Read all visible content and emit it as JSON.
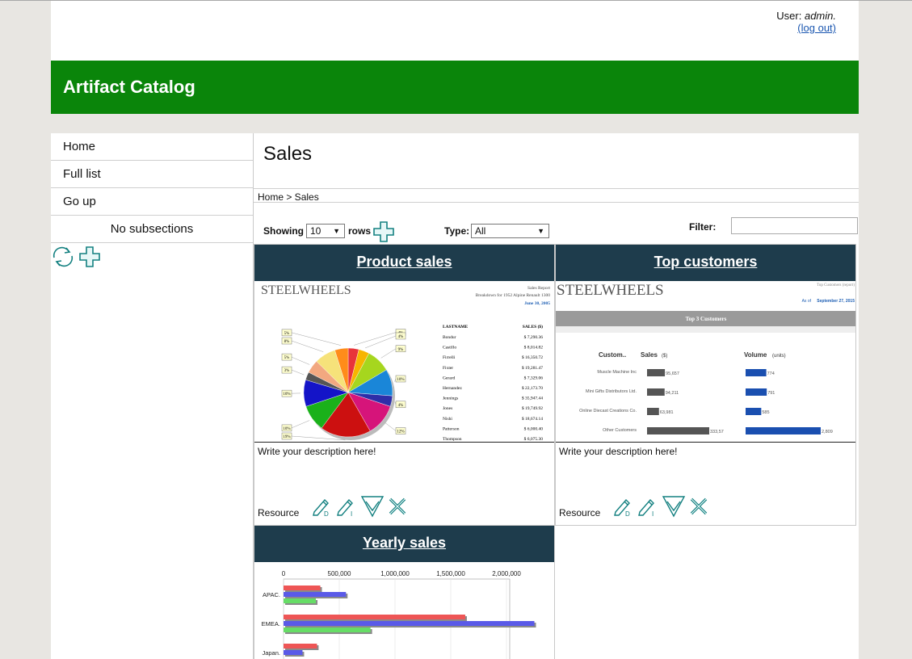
{
  "user": {
    "label": "User:",
    "name": "admin.",
    "logout": "(log out)"
  },
  "app_title": "Artifact Catalog",
  "sidebar": {
    "items": [
      {
        "label": "Home"
      },
      {
        "label": "Full list"
      },
      {
        "label": "Go up"
      }
    ],
    "no_subsections": "No subsections"
  },
  "main": {
    "title": "Sales",
    "breadcrumb": "Home > Sales",
    "showing_label": "Showing",
    "rows_value": "10",
    "rows_label": "rows",
    "type_label": "Type:",
    "type_value": "All",
    "filter_label": "Filter:",
    "filter_value": ""
  },
  "cards": [
    {
      "title": "Product sales",
      "description": "Write your description here!",
      "resource_label": "Resource",
      "thumb": {
        "brand": "STEELWHEELS",
        "report_title": "Sales Report",
        "report_sub": "Breakdown for 1952 Alpine Renault 1300",
        "report_date": "June 30, 2005",
        "col_name": "LASTNAME",
        "col_sales": "SALES ($)",
        "rows": [
          [
            "Bondur",
            "$ 7,290.36"
          ],
          [
            "Castillo",
            "$ 8,014.82"
          ],
          [
            "Firrelli",
            "$ 16,350.72"
          ],
          [
            "Fixter",
            "$ 19,281.47"
          ],
          [
            "Gerard",
            "$ 7,329.06"
          ],
          [
            "Hernandez",
            "$ 22,173.70"
          ],
          [
            "Jennings",
            "$ 35,947.44"
          ],
          [
            "Jones",
            "$ 19,749.92"
          ],
          [
            "Nishi",
            "$ 18,674.14"
          ],
          [
            "Patterson",
            "$ 6,000.40"
          ],
          [
            "Thompson",
            "$ 6,075.30"
          ]
        ],
        "pie": [
          {
            "value": 4,
            "color": "#e8343a",
            "label": "4%"
          },
          {
            "value": 4,
            "color": "#f7b500",
            "label": "4%"
          },
          {
            "value": 9,
            "color": "#a6d61e",
            "label": "9%"
          },
          {
            "value": 10,
            "color": "#1a86d8",
            "label": "10%"
          },
          {
            "value": 4,
            "color": "#2e2ea8",
            "label": "4%"
          },
          {
            "value": 12,
            "color": "#d6147a",
            "label": "12%"
          },
          {
            "value": 19,
            "color": "#cc1010",
            "label": "19%"
          },
          {
            "value": 10,
            "color": "#1ab11a",
            "label": "10%"
          },
          {
            "value": 10,
            "color": "#1414c8",
            "label": "10%"
          },
          {
            "value": 3,
            "color": "#555555",
            "label": "3%"
          },
          {
            "value": 5,
            "color": "#f2a880",
            "label": "5%"
          },
          {
            "value": 8,
            "color": "#f6e27a",
            "label": "8%"
          },
          {
            "value": 5,
            "color": "#ff8c1a",
            "label": "5%"
          }
        ]
      }
    },
    {
      "title": "Top customers",
      "description": "Write your description here!",
      "resource_label": "Resource",
      "thumb": {
        "brand": "STEELWHEELS",
        "report_title": "Top Customers (report)",
        "as_of_label": "As of",
        "report_date": "September 27, 2015",
        "band": "Top 3 Customers",
        "col_customer": "Custom..",
        "col_sales": "Sales",
        "col_sales_unit": "($)",
        "col_volume": "Volume",
        "col_volume_unit": "(units)",
        "rows": [
          {
            "name": "Muscle Machine Inc",
            "sales": 95657,
            "sales_label": "95,657",
            "volume": 774,
            "volume_label": "774"
          },
          {
            "name": "Mini Gifts Distributors Ltd.",
            "sales": 94211,
            "sales_label": "94,211",
            "volume": 791,
            "volume_label": "791"
          },
          {
            "name": "Online Diecast Creations Co.",
            "sales": 63981,
            "sales_label": "63,981",
            "volume": 585,
            "volume_label": "585"
          },
          {
            "name": "Other Customers",
            "sales": 333570,
            "sales_label": "333,57",
            "volume": 2809,
            "volume_label": "2,809"
          }
        ]
      }
    },
    {
      "title": "Yearly sales",
      "chart_data": {
        "type": "bar",
        "orientation": "horizontal",
        "xticks": [
          "0",
          "500,000",
          "1,000,000",
          "1,500,000",
          "2,000,000"
        ],
        "xlim": [
          0,
          2000000
        ],
        "categories": [
          "APAC.",
          "EMEA.",
          "Japan."
        ],
        "series": [
          {
            "values": [
              330000,
              1630000,
              300000
            ],
            "color": "#ee5555"
          },
          {
            "values": [
              560000,
              2250000,
              170000
            ],
            "color": "#5a5ae8"
          },
          {
            "values": [
              290000,
              780000,
              0
            ],
            "color": "#66dd66"
          }
        ]
      }
    }
  ]
}
